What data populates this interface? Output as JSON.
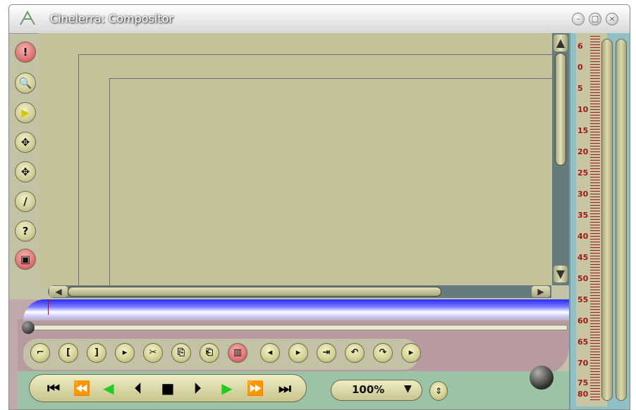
{
  "window": {
    "title": "Cinelerra: Compositor",
    "controls": [
      {
        "name": "minimize-button",
        "glyph": "–"
      },
      {
        "name": "maximize-button",
        "glyph": "□"
      },
      {
        "name": "close-button",
        "glyph": "×"
      }
    ]
  },
  "tools": [
    {
      "name": "protect-icon",
      "glyph": "!"
    },
    {
      "name": "zoom-icon",
      "glyph": "🔍"
    },
    {
      "name": "mask-icon",
      "glyph": "▶"
    },
    {
      "name": "camera-icon",
      "glyph": "✥"
    },
    {
      "name": "projector-icon",
      "glyph": "✥"
    },
    {
      "name": "crop-icon",
      "glyph": "/"
    },
    {
      "name": "help-icon",
      "glyph": "?"
    },
    {
      "name": "safe-region-icon",
      "glyph": "▣"
    }
  ],
  "edit_buttons": [
    {
      "name": "keyframe-icon",
      "glyph": "⌐"
    },
    {
      "name": "in-point-icon",
      "glyph": "["
    },
    {
      "name": "out-point-icon",
      "glyph": "]"
    },
    {
      "name": "label-icon",
      "glyph": "▸"
    },
    {
      "name": "cut-icon",
      "glyph": "✂"
    },
    {
      "name": "copy-icon",
      "glyph": "⎘"
    },
    {
      "name": "paste-icon",
      "glyph": "⎗"
    },
    {
      "name": "meters-icon",
      "glyph": "▥"
    },
    {
      "name": "prev-label-icon",
      "glyph": "◂"
    },
    {
      "name": "next-label-icon",
      "glyph": "▸"
    },
    {
      "name": "to-clip-icon",
      "glyph": "⇥"
    },
    {
      "name": "undo-icon",
      "glyph": "↶"
    },
    {
      "name": "redo-icon",
      "glyph": "↷"
    },
    {
      "name": "next-edit-icon",
      "glyph": "▸"
    }
  ],
  "transport": [
    {
      "name": "goto-start-icon",
      "glyph": "⏮",
      "color": "#000000"
    },
    {
      "name": "fast-rewind-icon",
      "glyph": "⏪",
      "color": "#22cc22"
    },
    {
      "name": "play-reverse-icon",
      "glyph": "◀",
      "color": "#22cc22"
    },
    {
      "name": "frame-back-icon",
      "glyph": "⏴",
      "color": "#000000"
    },
    {
      "name": "stop-icon",
      "glyph": "■",
      "color": "#000000"
    },
    {
      "name": "frame-forward-icon",
      "glyph": "⏵",
      "color": "#000000"
    },
    {
      "name": "play-icon",
      "glyph": "▶",
      "color": "#22cc22"
    },
    {
      "name": "fast-forward-icon",
      "glyph": "⏩",
      "color": "#22cc22"
    },
    {
      "name": "goto-end-icon",
      "glyph": "⏭",
      "color": "#000000"
    }
  ],
  "zoom": {
    "value": "100%",
    "arrow": "▼",
    "stepper": "⇕"
  },
  "meter": {
    "labels": [
      "6",
      "0",
      "5",
      "10",
      "15",
      "20",
      "25",
      "30",
      "35",
      "40",
      "45",
      "50",
      "55",
      "60",
      "65",
      "70",
      "75",
      "80"
    ]
  },
  "colors": {
    "accent_red": "#e07474",
    "playhead": "#d00000",
    "meter_text": "#a01818",
    "green_transport": "#22cc22"
  }
}
